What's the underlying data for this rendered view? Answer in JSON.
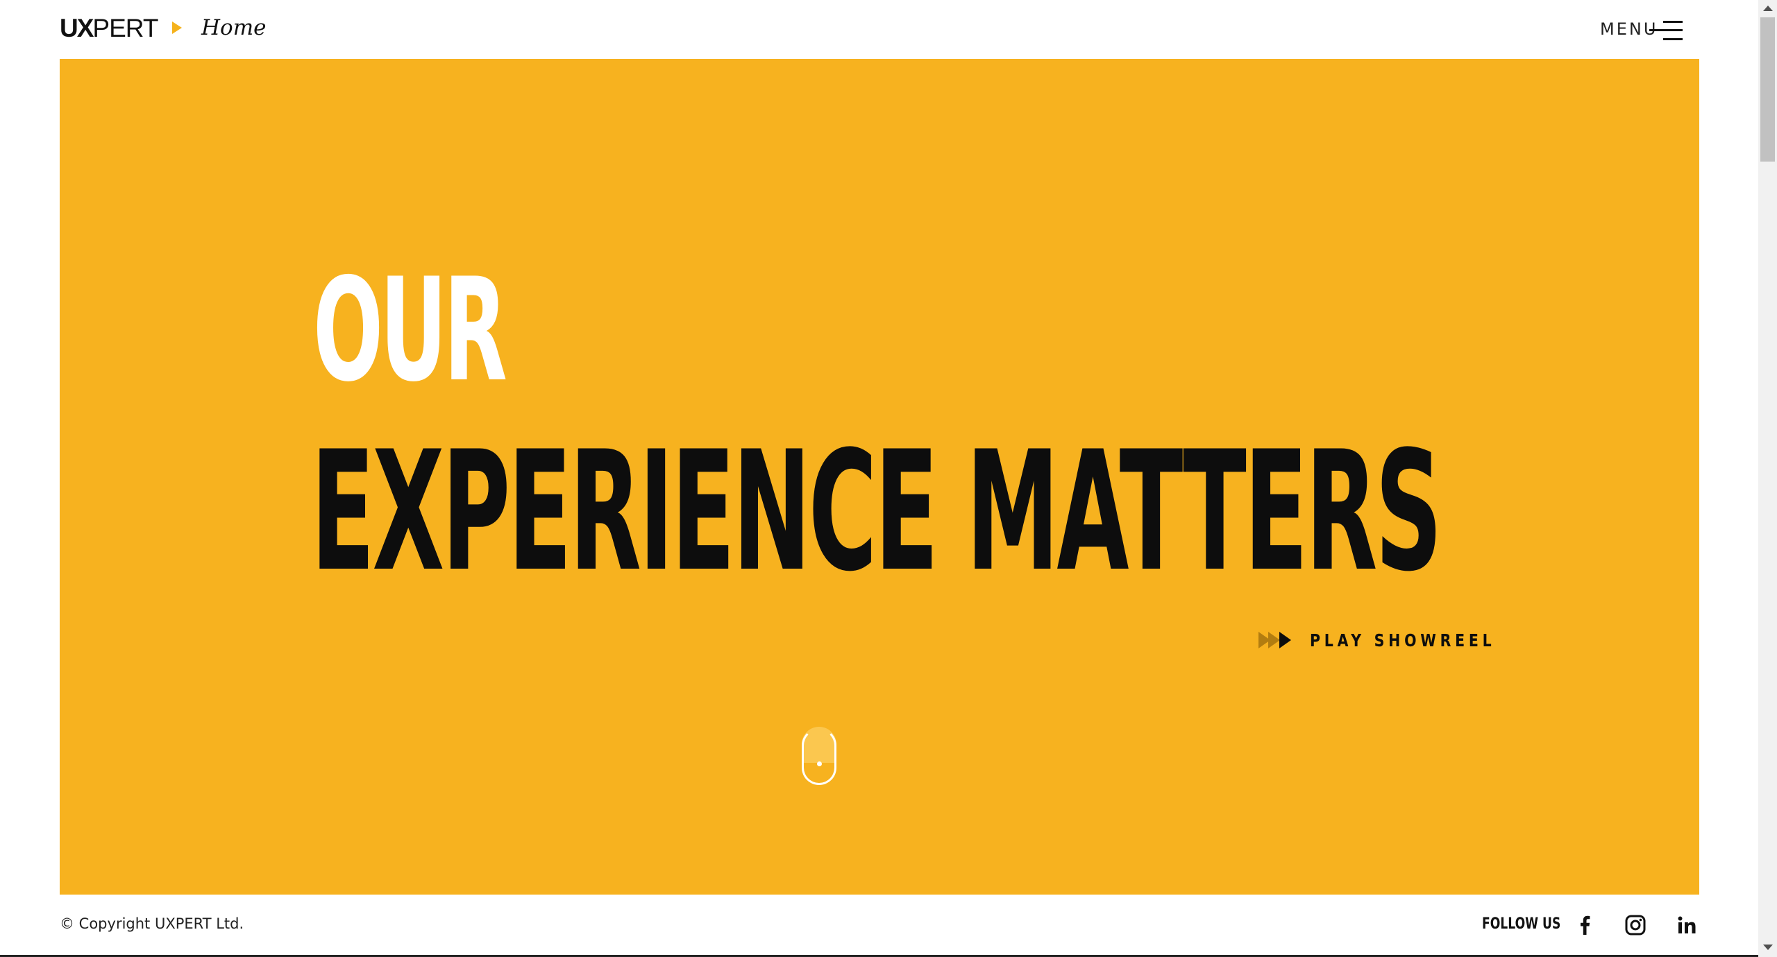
{
  "header": {
    "logo_bold": "UX",
    "logo_light": "PERT",
    "breadcrumb_current": "Home",
    "menu_label": "MENU"
  },
  "hero": {
    "line1": "OUR",
    "line2": "EXPERIENCE MATTERS",
    "showreel_label": "PLAY SHOWREEL"
  },
  "footer": {
    "copyright": "© Copyright UXPERT Ltd.",
    "follow_label": "FOLLOW US",
    "social": [
      "facebook-icon",
      "instagram-icon",
      "linkedin-icon"
    ]
  },
  "colors": {
    "accent": "#f7b21f",
    "hero_headline_primary": "#ffffff",
    "hero_headline_secondary": "#0d0d0d",
    "text": "#111111"
  }
}
